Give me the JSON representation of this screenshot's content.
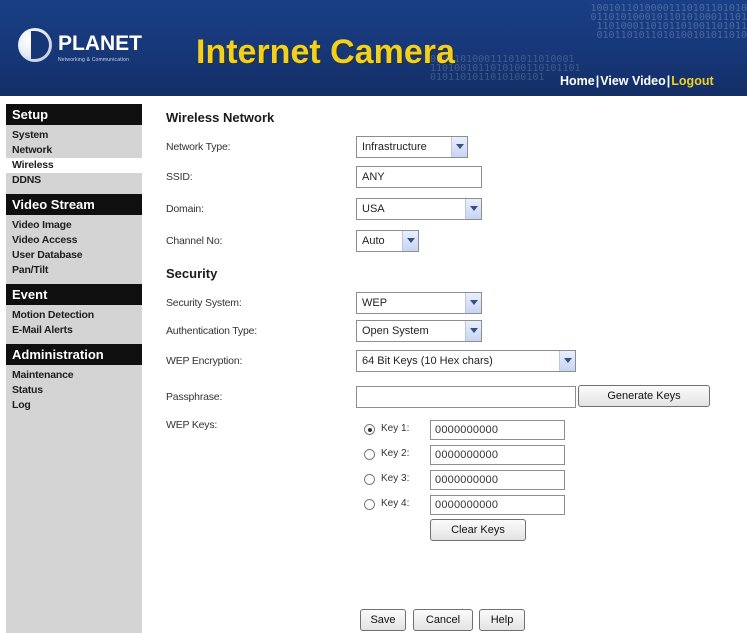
{
  "header": {
    "brand": "PLANET",
    "brand_tagline": "Networking & Communication",
    "title": "Internet Camera",
    "nav": {
      "home": "Home",
      "view_video": "View Video",
      "logout": "Logout"
    }
  },
  "sidebar": {
    "sections": [
      {
        "title": "Setup",
        "items": [
          "System",
          "Network",
          "Wireless",
          "DDNS"
        ]
      },
      {
        "title": "Video Stream",
        "items": [
          "Video Image",
          "Video Access",
          "User Database",
          "Pan/Tilt"
        ]
      },
      {
        "title": "Event",
        "items": [
          "Motion Detection",
          "E-Mail Alerts"
        ]
      },
      {
        "title": "Administration",
        "items": [
          "Maintenance",
          "Status",
          "Log"
        ]
      }
    ],
    "active_item": "Wireless"
  },
  "wireless": {
    "heading": "Wireless Network",
    "network_type": {
      "label": "Network Type:",
      "value": "Infrastructure"
    },
    "ssid": {
      "label": "SSID:",
      "value": "ANY"
    },
    "domain": {
      "label": "Domain:",
      "value": "USA"
    },
    "channel": {
      "label": "Channel No:",
      "value": "Auto"
    }
  },
  "security": {
    "heading": "Security",
    "system": {
      "label": "Security System:",
      "value": "WEP"
    },
    "auth_type": {
      "label": "Authentication Type:",
      "value": "Open System"
    },
    "wep_encryption": {
      "label": "WEP Encryption:",
      "value": "64 Bit Keys (10 Hex chars)"
    },
    "passphrase": {
      "label": "Passphrase:",
      "value": ""
    },
    "generate_keys_label": "Generate Keys",
    "wep_keys_label": "WEP Keys:",
    "keys": [
      {
        "label": "Key 1:",
        "value": "0000000000",
        "selected": true
      },
      {
        "label": "Key 2:",
        "value": "0000000000",
        "selected": false
      },
      {
        "label": "Key 3:",
        "value": "0000000000",
        "selected": false
      },
      {
        "label": "Key 4:",
        "value": "0000000000",
        "selected": false
      }
    ],
    "clear_keys_label": "Clear Keys"
  },
  "footer": {
    "save_label": "Save",
    "cancel_label": "Cancel",
    "help_label": "Help"
  },
  "colors": {
    "banner": "#163676",
    "title": "#f0d020",
    "sidebar": "#d4d4d4",
    "section_header": "#0f0f0f"
  }
}
